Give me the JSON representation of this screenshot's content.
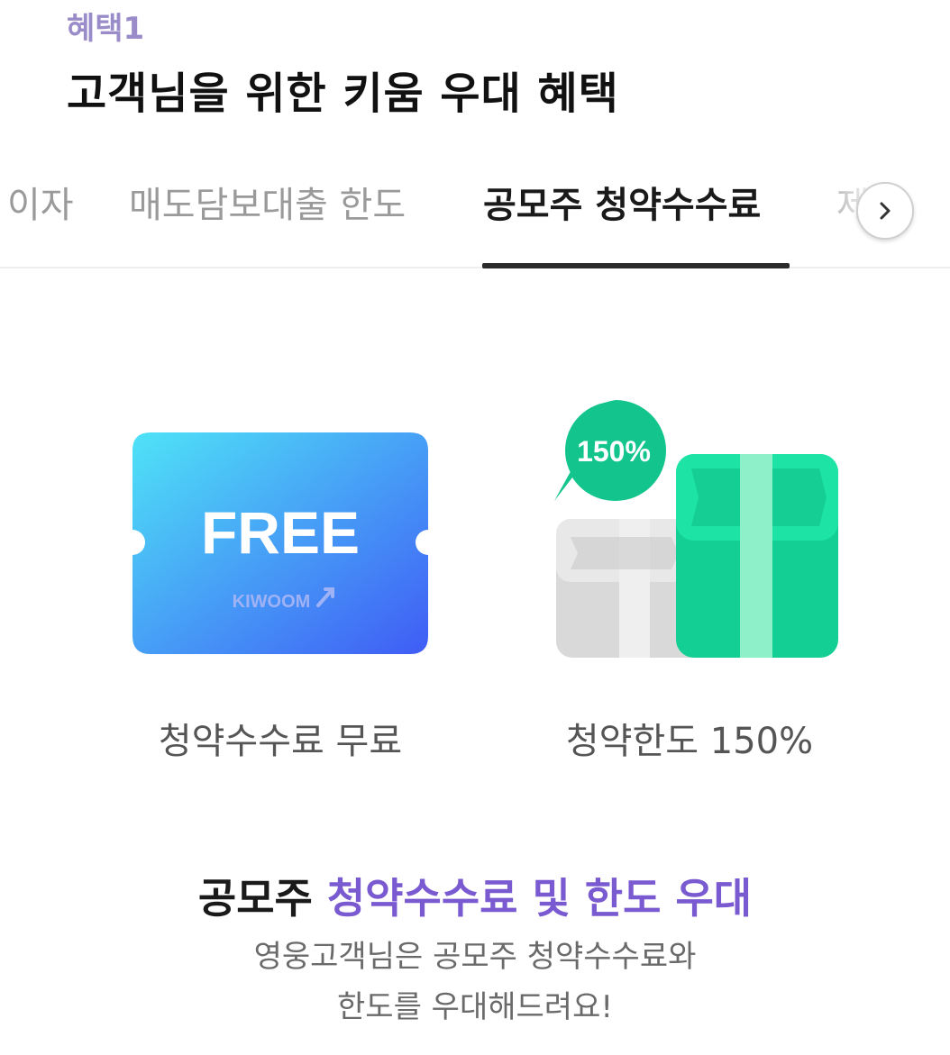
{
  "header": {
    "benefit_label": "혜택1",
    "title": "고객님을 위한 키움 우대 혜택"
  },
  "tabs": {
    "items": [
      {
        "label": "이자"
      },
      {
        "label": "매도담보대출 한도"
      },
      {
        "label": "공모주 청약수수료"
      },
      {
        "label": "제"
      }
    ],
    "active_index": 2,
    "next_icon": "chevron-right-icon"
  },
  "features": [
    {
      "icon": "free-ticket-icon",
      "ticket_text": "FREE",
      "brand_text": "KIWOOM",
      "caption": "청약수수료 무료",
      "colors": {
        "gradient_start": "#4fe3f7",
        "gradient_end": "#3f5cf5"
      }
    },
    {
      "icon": "money-gift-box-icon",
      "badge_text": "150%",
      "caption": "청약한도 150%",
      "colors": {
        "primary": "#1ad49a",
        "secondary": "#d9d9d9"
      }
    }
  ],
  "summary": {
    "title_plain": "공모주 ",
    "title_accent": "청약수수료 및 한도 우대",
    "description_line1": "영웅고객님은 공모주 청약수수료와",
    "description_line2": "한도를 우대해드려요!"
  },
  "colors": {
    "accent_purple": "#7a5ad0",
    "label_purple": "#9a8cc9",
    "green": "#1ad49a"
  }
}
